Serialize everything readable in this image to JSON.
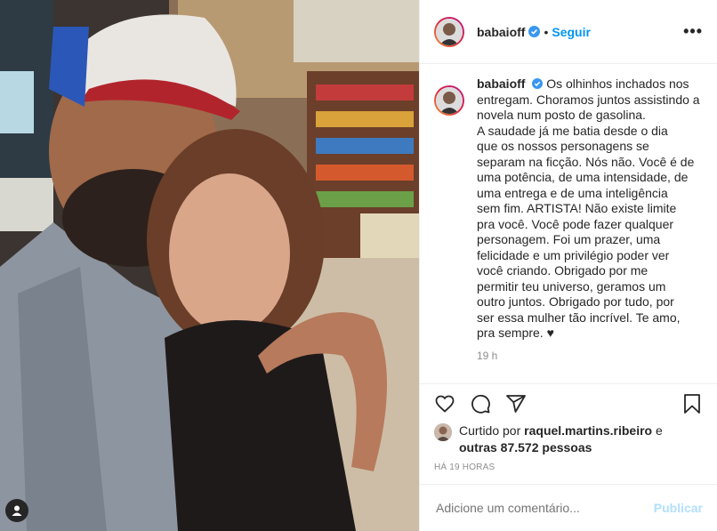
{
  "header": {
    "username": "babaioff",
    "separator": "•",
    "follow_label": "Seguir",
    "more_label": "•••"
  },
  "caption": {
    "username": "babaioff",
    "text": "Os olhinhos inchados nos entregam. Choramos juntos assistindo a novela num posto de gasolina.",
    "lines": [
      "A saudade já me batia desde o dia",
      "que os nossos personagens se",
      "separam na ficção. Nós não. Você é de",
      "uma potência, de uma intensidade, de",
      "uma entrega e de uma inteligência",
      "sem fim. ARTISTA! Não existe limite",
      "pra você. Você pode fazer qualquer",
      "personagem. Foi um prazer, uma",
      "felicidade e um privilégio poder ver",
      "você criando. Obrigado por me",
      "permitir teu universo, geramos um",
      "outro juntos. Obrigado por tudo, por",
      "ser essa mulher tão incrível. Te amo,",
      "pra sempre. ♥"
    ],
    "time": "19 h"
  },
  "actions": {
    "like_icon": "heart-icon",
    "comment_icon": "comment-icon",
    "share_icon": "share-icon",
    "save_icon": "bookmark-icon"
  },
  "likes": {
    "prefix": "Curtido por",
    "user": "raquel.martins.ribeiro",
    "and": "e",
    "others": "outras 87.572 pessoas"
  },
  "timestamp": "HÁ 19 HORAS",
  "comment_box": {
    "placeholder": "Adicione um comentário...",
    "publish_label": "Publicar"
  },
  "colors": {
    "accent": "#0095f6",
    "verified": "#3897f0",
    "publish_disabled": "#b2dffc",
    "muted": "#8e8e8e"
  }
}
